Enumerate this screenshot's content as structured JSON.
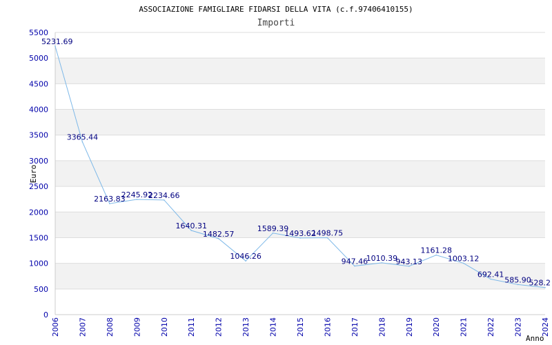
{
  "chart_data": {
    "type": "line",
    "title": "ASSOCIAZIONE FAMIGLIARE FIDARSI DELLA VITA (c.f.97406410155)",
    "subtitle": "Importi",
    "xlabel": "Anno",
    "ylabel": "Euro",
    "ylim": [
      0,
      5500
    ],
    "yticks": [
      "0",
      "500",
      "1000",
      "1500",
      "2000",
      "2500",
      "3000",
      "3500",
      "4000",
      "4500",
      "5000",
      "5500"
    ],
    "categories": [
      "2006",
      "2007",
      "2008",
      "2009",
      "2010",
      "2011",
      "2012",
      "2013",
      "2014",
      "2015",
      "2016",
      "2017",
      "2018",
      "2019",
      "2020",
      "2021",
      "2022",
      "2023",
      "2024"
    ],
    "values": [
      5231.69,
      3365.44,
      2163.83,
      2245.92,
      2234.66,
      1640.31,
      1482.57,
      1046.26,
      1589.39,
      1493.62,
      1498.75,
      947.46,
      1010.39,
      943.13,
      1161.28,
      1003.12,
      692.41,
      585.9,
      528.2
    ],
    "value_labels": [
      "5231.69",
      "3365.44",
      "2163.83",
      "2245.92",
      "2234.66",
      "1640.31",
      "1482.57",
      "1046.26",
      "1589.39",
      "1493.62",
      "1498.75",
      "947.46",
      "1010.39",
      "943.13",
      "1161.28",
      "1003.12",
      "692.41",
      "585.90",
      "528.2"
    ],
    "grid": true,
    "colors": {
      "line": "#7db8e8",
      "axis_text": "#0000aa",
      "label_text": "#000080",
      "band": "#f2f2f2",
      "grid": "#dddddd"
    }
  }
}
